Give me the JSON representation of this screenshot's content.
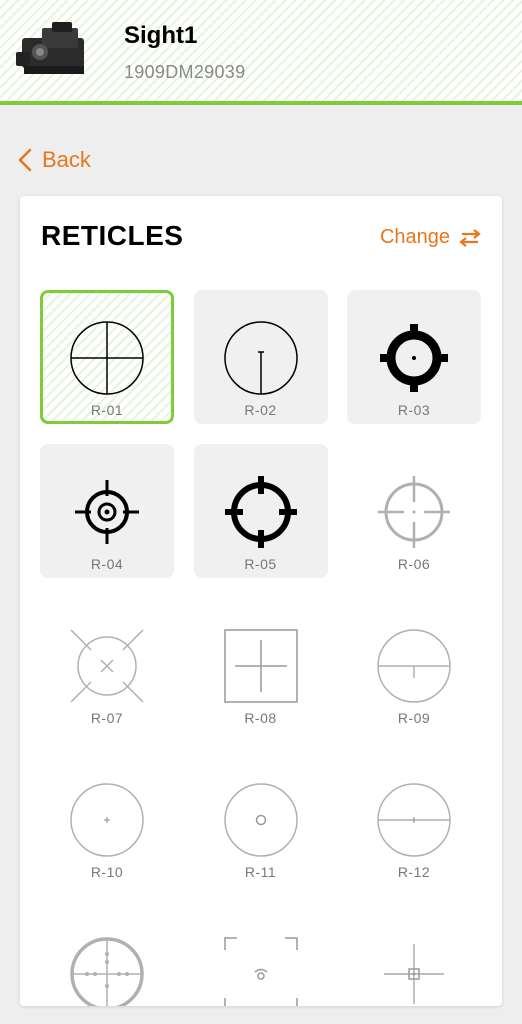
{
  "header": {
    "device_name": "Sight1",
    "serial": "1909DM29039",
    "accent_color": "#7ccd3a"
  },
  "nav": {
    "back_label": "Back",
    "back_icon": "chevron-left-icon"
  },
  "reticles": {
    "title": "RETICLES",
    "change_label": "Change",
    "change_icon": "swap-arrows-icon",
    "selected": "R-01",
    "items": [
      {
        "label": "R-01",
        "state": "selected"
      },
      {
        "label": "R-02",
        "state": "available"
      },
      {
        "label": "R-03",
        "state": "available"
      },
      {
        "label": "R-04",
        "state": "available"
      },
      {
        "label": "R-05",
        "state": "available"
      },
      {
        "label": "R-06",
        "state": "unavailable"
      },
      {
        "label": "R-07",
        "state": "unavailable"
      },
      {
        "label": "R-08",
        "state": "unavailable"
      },
      {
        "label": "R-09",
        "state": "unavailable"
      },
      {
        "label": "R-10",
        "state": "unavailable"
      },
      {
        "label": "R-11",
        "state": "unavailable"
      },
      {
        "label": "R-12",
        "state": "unavailable"
      },
      {
        "label": "",
        "state": "unavailable"
      },
      {
        "label": "",
        "state": "unavailable"
      },
      {
        "label": "",
        "state": "unavailable"
      }
    ]
  },
  "colors": {
    "orange": "#e8761c",
    "green": "#7ccd3a"
  }
}
